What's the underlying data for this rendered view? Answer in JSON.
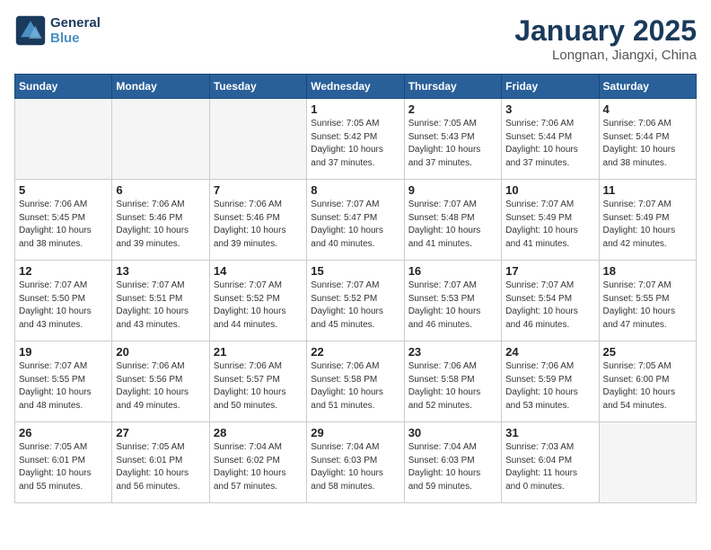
{
  "header": {
    "logo_line1": "General",
    "logo_line2": "Blue",
    "month_title": "January 2025",
    "location": "Longnan, Jiangxi, China"
  },
  "weekdays": [
    "Sunday",
    "Monday",
    "Tuesday",
    "Wednesday",
    "Thursday",
    "Friday",
    "Saturday"
  ],
  "weeks": [
    [
      {
        "day": "",
        "info": ""
      },
      {
        "day": "",
        "info": ""
      },
      {
        "day": "",
        "info": ""
      },
      {
        "day": "1",
        "info": "Sunrise: 7:05 AM\nSunset: 5:42 PM\nDaylight: 10 hours\nand 37 minutes."
      },
      {
        "day": "2",
        "info": "Sunrise: 7:05 AM\nSunset: 5:43 PM\nDaylight: 10 hours\nand 37 minutes."
      },
      {
        "day": "3",
        "info": "Sunrise: 7:06 AM\nSunset: 5:44 PM\nDaylight: 10 hours\nand 37 minutes."
      },
      {
        "day": "4",
        "info": "Sunrise: 7:06 AM\nSunset: 5:44 PM\nDaylight: 10 hours\nand 38 minutes."
      }
    ],
    [
      {
        "day": "5",
        "info": "Sunrise: 7:06 AM\nSunset: 5:45 PM\nDaylight: 10 hours\nand 38 minutes."
      },
      {
        "day": "6",
        "info": "Sunrise: 7:06 AM\nSunset: 5:46 PM\nDaylight: 10 hours\nand 39 minutes."
      },
      {
        "day": "7",
        "info": "Sunrise: 7:06 AM\nSunset: 5:46 PM\nDaylight: 10 hours\nand 39 minutes."
      },
      {
        "day": "8",
        "info": "Sunrise: 7:07 AM\nSunset: 5:47 PM\nDaylight: 10 hours\nand 40 minutes."
      },
      {
        "day": "9",
        "info": "Sunrise: 7:07 AM\nSunset: 5:48 PM\nDaylight: 10 hours\nand 41 minutes."
      },
      {
        "day": "10",
        "info": "Sunrise: 7:07 AM\nSunset: 5:49 PM\nDaylight: 10 hours\nand 41 minutes."
      },
      {
        "day": "11",
        "info": "Sunrise: 7:07 AM\nSunset: 5:49 PM\nDaylight: 10 hours\nand 42 minutes."
      }
    ],
    [
      {
        "day": "12",
        "info": "Sunrise: 7:07 AM\nSunset: 5:50 PM\nDaylight: 10 hours\nand 43 minutes."
      },
      {
        "day": "13",
        "info": "Sunrise: 7:07 AM\nSunset: 5:51 PM\nDaylight: 10 hours\nand 43 minutes."
      },
      {
        "day": "14",
        "info": "Sunrise: 7:07 AM\nSunset: 5:52 PM\nDaylight: 10 hours\nand 44 minutes."
      },
      {
        "day": "15",
        "info": "Sunrise: 7:07 AM\nSunset: 5:52 PM\nDaylight: 10 hours\nand 45 minutes."
      },
      {
        "day": "16",
        "info": "Sunrise: 7:07 AM\nSunset: 5:53 PM\nDaylight: 10 hours\nand 46 minutes."
      },
      {
        "day": "17",
        "info": "Sunrise: 7:07 AM\nSunset: 5:54 PM\nDaylight: 10 hours\nand 46 minutes."
      },
      {
        "day": "18",
        "info": "Sunrise: 7:07 AM\nSunset: 5:55 PM\nDaylight: 10 hours\nand 47 minutes."
      }
    ],
    [
      {
        "day": "19",
        "info": "Sunrise: 7:07 AM\nSunset: 5:55 PM\nDaylight: 10 hours\nand 48 minutes."
      },
      {
        "day": "20",
        "info": "Sunrise: 7:06 AM\nSunset: 5:56 PM\nDaylight: 10 hours\nand 49 minutes."
      },
      {
        "day": "21",
        "info": "Sunrise: 7:06 AM\nSunset: 5:57 PM\nDaylight: 10 hours\nand 50 minutes."
      },
      {
        "day": "22",
        "info": "Sunrise: 7:06 AM\nSunset: 5:58 PM\nDaylight: 10 hours\nand 51 minutes."
      },
      {
        "day": "23",
        "info": "Sunrise: 7:06 AM\nSunset: 5:58 PM\nDaylight: 10 hours\nand 52 minutes."
      },
      {
        "day": "24",
        "info": "Sunrise: 7:06 AM\nSunset: 5:59 PM\nDaylight: 10 hours\nand 53 minutes."
      },
      {
        "day": "25",
        "info": "Sunrise: 7:05 AM\nSunset: 6:00 PM\nDaylight: 10 hours\nand 54 minutes."
      }
    ],
    [
      {
        "day": "26",
        "info": "Sunrise: 7:05 AM\nSunset: 6:01 PM\nDaylight: 10 hours\nand 55 minutes."
      },
      {
        "day": "27",
        "info": "Sunrise: 7:05 AM\nSunset: 6:01 PM\nDaylight: 10 hours\nand 56 minutes."
      },
      {
        "day": "28",
        "info": "Sunrise: 7:04 AM\nSunset: 6:02 PM\nDaylight: 10 hours\nand 57 minutes."
      },
      {
        "day": "29",
        "info": "Sunrise: 7:04 AM\nSunset: 6:03 PM\nDaylight: 10 hours\nand 58 minutes."
      },
      {
        "day": "30",
        "info": "Sunrise: 7:04 AM\nSunset: 6:03 PM\nDaylight: 10 hours\nand 59 minutes."
      },
      {
        "day": "31",
        "info": "Sunrise: 7:03 AM\nSunset: 6:04 PM\nDaylight: 11 hours\nand 0 minutes."
      },
      {
        "day": "",
        "info": ""
      }
    ]
  ]
}
